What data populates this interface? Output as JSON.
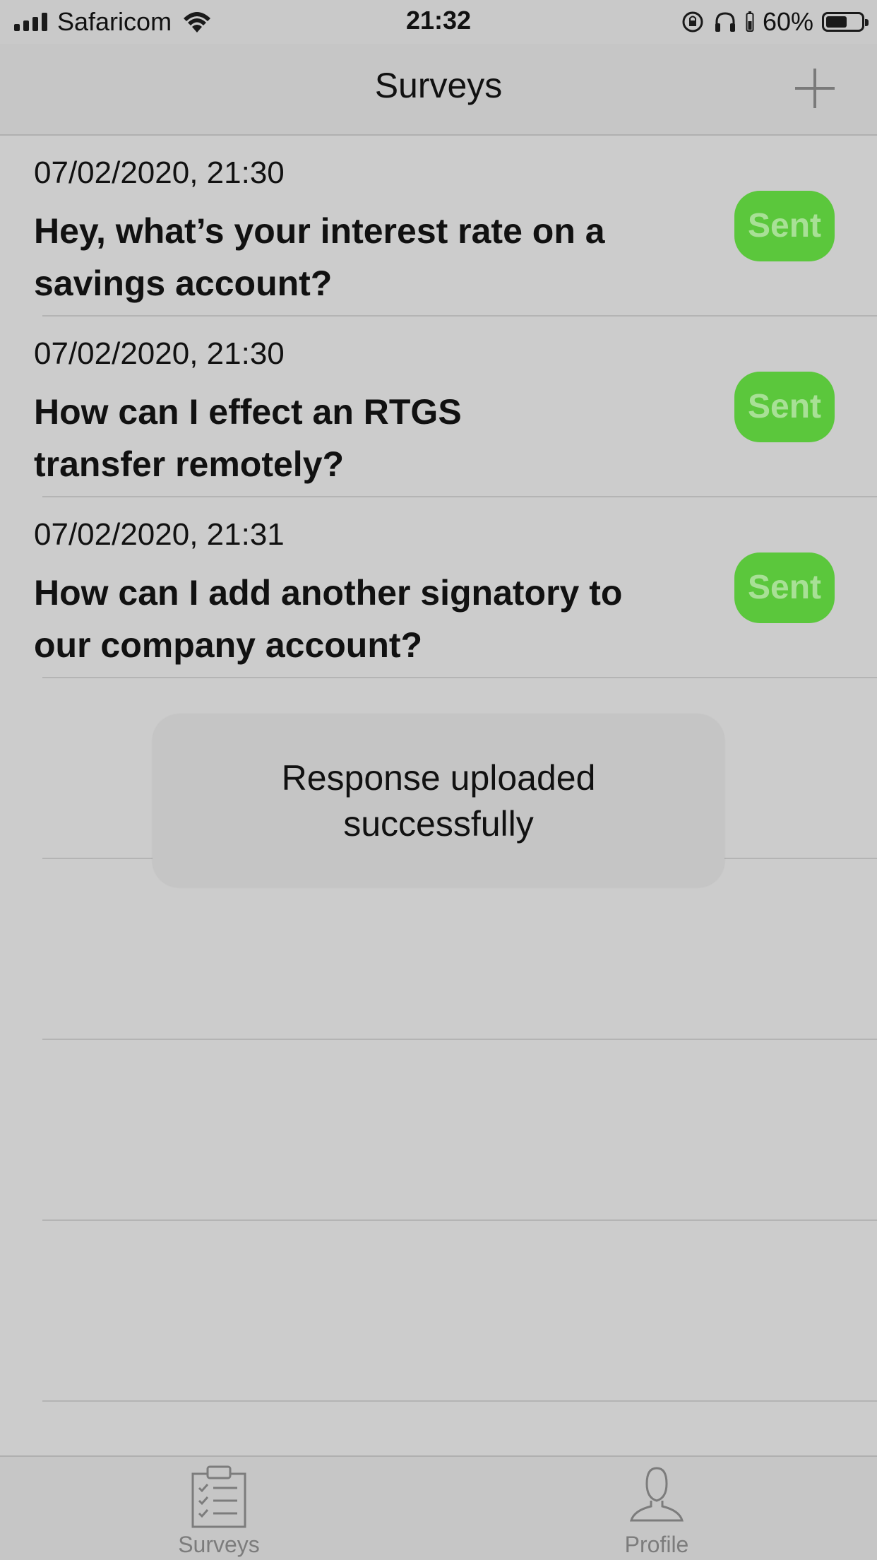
{
  "status_bar": {
    "carrier": "Safaricom",
    "time": "21:32",
    "battery_percent": "60%",
    "battery_level": 0.6
  },
  "nav": {
    "title": "Surveys"
  },
  "surveys": [
    {
      "date": "07/02/2020, 21:30",
      "question": "Hey, what’s your interest rate on a savings account?",
      "status": "Sent"
    },
    {
      "date": "07/02/2020, 21:30",
      "question": "How can I effect an RTGS transfer remotely?",
      "status": "Sent"
    },
    {
      "date": "07/02/2020, 21:31",
      "question": "How can I add another signatory to our company account?",
      "status": "Sent"
    }
  ],
  "toast": {
    "message": "Response uploaded successfully"
  },
  "tabs": [
    {
      "label": "Surveys",
      "icon": "clipboard-checklist-icon"
    },
    {
      "label": "Profile",
      "icon": "person-icon"
    }
  ],
  "colors": {
    "sent_badge": "#5bc73c",
    "background": "#cccccc"
  }
}
